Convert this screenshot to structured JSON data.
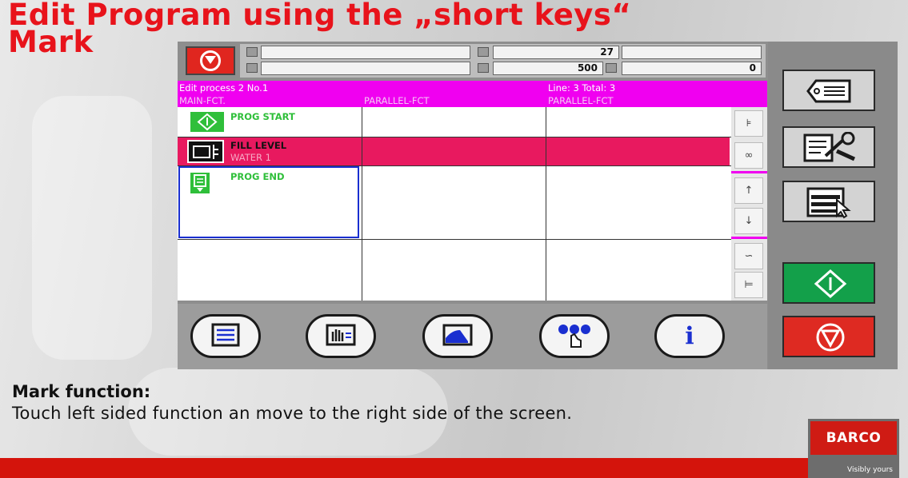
{
  "slide": {
    "title": "Edit Program using the „short keys“\nMark",
    "mark_heading": "Mark function:",
    "instruction": "Touch left sided function an move to the right side of the screen."
  },
  "colors": {
    "title_red": "#e8131b",
    "header_magenta": "#f000f0",
    "marked_row": "#e8195f",
    "function_green": "#2fbf3a",
    "start_button_green": "#13a04a",
    "stop_button_red": "#de2a22"
  },
  "status": {
    "value_top": "27",
    "value_bottom_mid": "500",
    "value_bottom_right": "0"
  },
  "editor": {
    "header_line1_left": "Edit process 2 No.1",
    "header_line1_right": "Line: 3 Total: 3",
    "columns": [
      "MAIN-FCT.",
      "PARALLEL-FCT",
      "PARALLEL-FCT"
    ],
    "rows": [
      {
        "label": "PROG START",
        "icon": "prog-start-icon"
      },
      {
        "label": "FILL LEVEL",
        "sublabel": "WATER 1",
        "icon": "fill-level-icon"
      },
      {
        "label": "PROG END",
        "icon": "prog-end-icon"
      }
    ]
  },
  "toolbar_icons": [
    "list-icon",
    "hand-select-icon",
    "curve-icon",
    "touch-dots-icon",
    "info-icon"
  ],
  "info_glyph": "i",
  "right_panel_icons": [
    "tag-icon",
    "edit-tool-icon",
    "form-pointer-icon",
    "start-icon",
    "stop-icon"
  ],
  "logo": {
    "brand": "BARCO",
    "tagline": "Visibly yours"
  }
}
